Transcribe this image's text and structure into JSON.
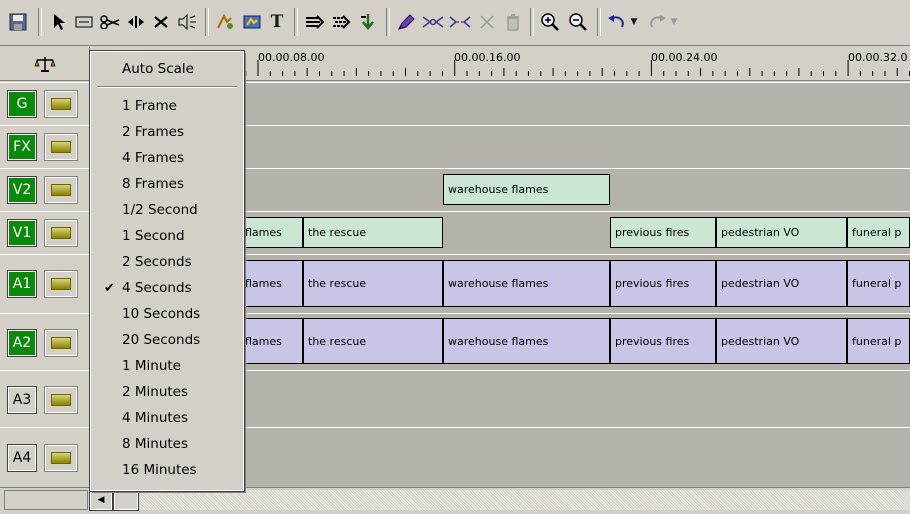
{
  "ruler": {
    "ticks": [
      "00.00.08.00",
      "00.00.16.00",
      "00.00.24.00",
      "00.00.32.0"
    ]
  },
  "tracks": [
    {
      "label": "G"
    },
    {
      "label": "FX"
    },
    {
      "label": "V2"
    },
    {
      "label": "V1"
    },
    {
      "label": "A1"
    },
    {
      "label": "A2"
    },
    {
      "label": "A3"
    },
    {
      "label": "A4"
    }
  ],
  "clips": {
    "v2": [
      "warehouse flames"
    ],
    "v1": [
      "flames",
      "the rescue",
      "previous fires",
      "pedestrian VO",
      "funeral p"
    ],
    "a1": [
      "flames",
      "the rescue",
      "warehouse flames",
      "previous fires",
      "pedestrian VO",
      "funeral p"
    ],
    "a2": [
      "flames",
      "the rescue",
      "warehouse flames",
      "previous fires",
      "pedestrian VO",
      "funeral p"
    ]
  },
  "menu": {
    "auto_scale": "Auto Scale",
    "items": [
      "1 Frame",
      "2 Frames",
      "4 Frames",
      "8 Frames",
      "1/2 Second",
      "1 Second",
      "2 Seconds",
      "4 Seconds",
      "10 Seconds",
      "20 Seconds",
      "1 Minute",
      "2 Minutes",
      "4 Minutes",
      "8 Minutes",
      "16 Minutes"
    ],
    "checked": "4 Seconds",
    "check_glyph": "✔"
  },
  "colors": {
    "video_clip": "#cce6d6",
    "audio_clip": "#c7c6e6",
    "track_on": "#0a8a0a"
  }
}
